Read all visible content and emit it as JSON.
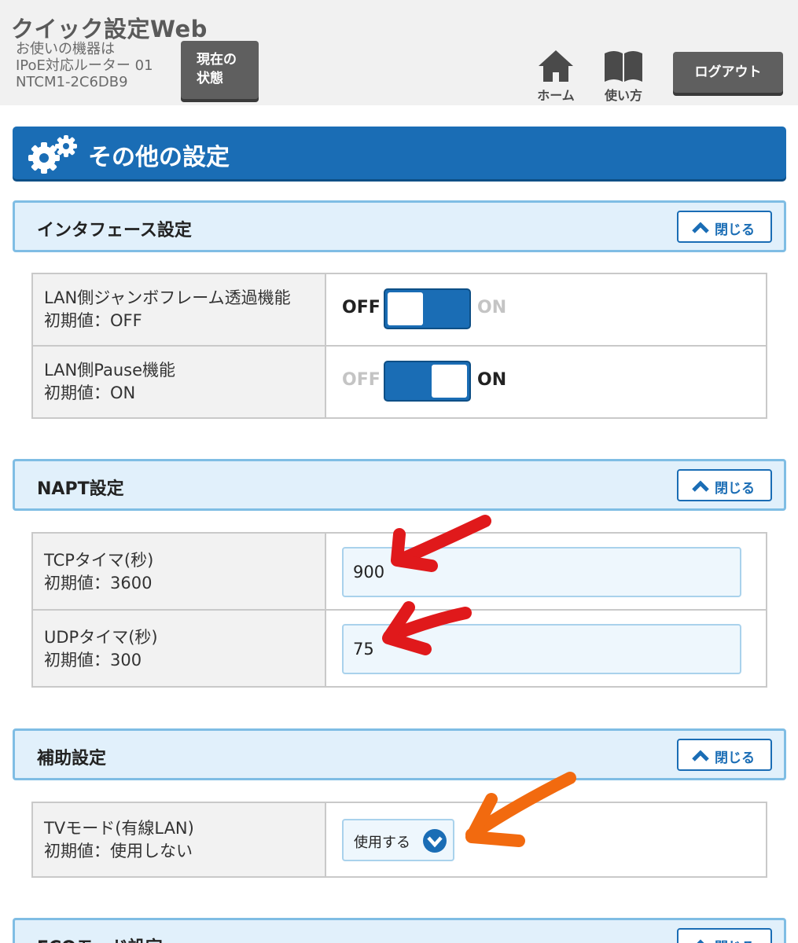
{
  "header": {
    "app_title": "クイック設定Web",
    "device_info": [
      "お使いの機器は",
      "IPoE対応ルーター 01",
      "NTCM1-2C6DB9"
    ],
    "status_button": [
      "現在の",
      "状態"
    ],
    "home_label": "ホーム",
    "howto_label": "使い方",
    "logout_label": "ログアウト"
  },
  "page_title": "その他の設定",
  "sections": {
    "interface": {
      "title": "インタフェース設定",
      "close_label": "閉じる",
      "rows": [
        {
          "label": "LAN側ジャンボフレーム透過機能",
          "default": "初期値：OFF",
          "off_label": "OFF",
          "on_label": "ON",
          "state": "OFF"
        },
        {
          "label": "LAN側Pause機能",
          "default": "初期値：ON",
          "off_label": "OFF",
          "on_label": "ON",
          "state": "ON"
        }
      ]
    },
    "napt": {
      "title": "NAPT設定",
      "close_label": "閉じる",
      "rows": [
        {
          "label": "TCPタイマ(秒)",
          "default": "初期値：3600",
          "value": "900"
        },
        {
          "label": "UDPタイマ(秒)",
          "default": "初期値：300",
          "value": "75"
        }
      ]
    },
    "aux": {
      "title": "補助設定",
      "close_label": "閉じる",
      "rows": [
        {
          "label": "TVモード(有線LAN)",
          "default": "初期値：使用しない",
          "selected": "使用する"
        }
      ]
    },
    "eco": {
      "title": "ECOモード設定",
      "close_label": "閉じる"
    }
  },
  "colors": {
    "primary": "#1a6db5",
    "section_bg": "#e1f0fb",
    "section_border": "#7fbde4",
    "annotation_red": "#e0191b",
    "annotation_orange": "#f26a0f"
  },
  "icons": [
    "home-icon",
    "book-icon",
    "gear-icon",
    "chevron-up-icon",
    "chevron-down-icon"
  ]
}
